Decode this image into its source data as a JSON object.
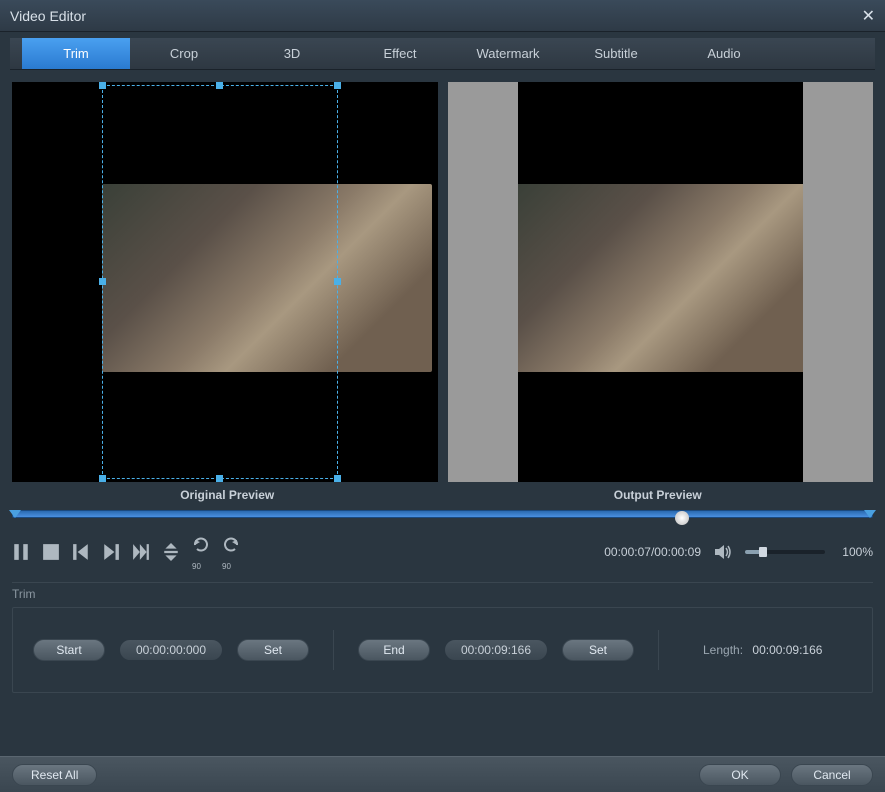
{
  "window": {
    "title": "Video Editor"
  },
  "tabs": [
    "Trim",
    "Crop",
    "3D",
    "Effect",
    "Watermark",
    "Subtitle",
    "Audio"
  ],
  "active_tab": 0,
  "preview_labels": {
    "original": "Original Preview",
    "output": "Output Preview"
  },
  "playback": {
    "current": "00:00:07",
    "total": "00:00:09",
    "volume_percent": "100%"
  },
  "trim": {
    "section_label": "Trim",
    "start_btn": "Start",
    "start_value": "00:00:00:000",
    "start_set": "Set",
    "end_btn": "End",
    "end_value": "00:00:09:166",
    "end_set": "Set",
    "length_label": "Length:",
    "length_value": "00:00:09:166"
  },
  "footer": {
    "reset": "Reset All",
    "ok": "OK",
    "cancel": "Cancel"
  }
}
